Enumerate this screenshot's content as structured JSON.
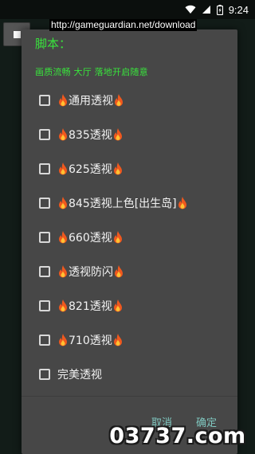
{
  "status_bar": {
    "time": "9:24",
    "icons": [
      "wifi-icon",
      "cellular-signal-icon",
      "battery-icon"
    ]
  },
  "overlay": {
    "url_banner": "http://gameguardian.net/download",
    "float_button_icon": "stop-square-icon"
  },
  "dialog": {
    "title": "脚本：",
    "subtitle": "画质流畅 大厅 落地开启随意",
    "options": [
      {
        "label": "通用透视",
        "checked": false,
        "flames": true
      },
      {
        "label": "835透视",
        "checked": false,
        "flames": true
      },
      {
        "label": "625透视",
        "checked": false,
        "flames": true
      },
      {
        "label": "845透视上色[出生岛]",
        "checked": false,
        "flames": true
      },
      {
        "label": "660透视",
        "checked": false,
        "flames": true
      },
      {
        "label": "透视防闪",
        "checked": false,
        "flames": true
      },
      {
        "label": "821透视",
        "checked": false,
        "flames": true
      },
      {
        "label": "710透视",
        "checked": false,
        "flames": true
      },
      {
        "label": "完美透视",
        "checked": false,
        "flames": false
      }
    ],
    "cancel_label": "取消",
    "ok_label": "确定"
  },
  "watermark": "03737.com",
  "colors": {
    "accent_green": "#39e43c",
    "dialog_bg": "#474747",
    "button_text": "#7fc7bf"
  }
}
